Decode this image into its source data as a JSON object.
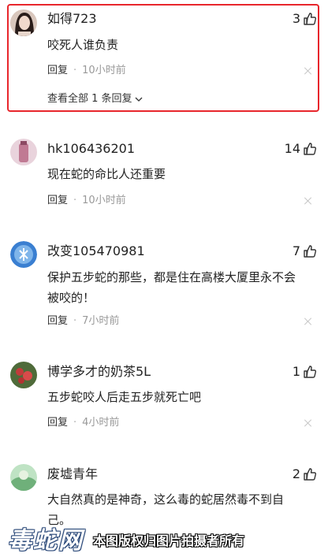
{
  "colors": {
    "highlight_border": "#e8262c",
    "meta_time": "#999999",
    "text": "#222222"
  },
  "comments": [
    {
      "username": "如得723",
      "likes": "3",
      "text": "咬死人谁负责",
      "reply_label": "回复",
      "separator": "·",
      "time": "10小时前",
      "view_all": "查看全部 1 条回复",
      "avatar_icon": "woman-portrait-icon"
    },
    {
      "username": "hk106436201",
      "likes": "14",
      "text": "现在蛇的命比人还重要",
      "reply_label": "回复",
      "separator": "·",
      "time": "10小时前",
      "avatar_icon": "pink-bottle-icon"
    },
    {
      "username": "改变105470981",
      "likes": "7",
      "text_line1": "保护五步蛇的那些，都是住在高楼大厦里永不会",
      "text_line2": "被咬的！",
      "reply_label": "回复",
      "separator": "·",
      "time": "7小时前",
      "avatar_icon": "blue-ice-icon"
    },
    {
      "username": "博学多才的奶茶5L",
      "likes": "1",
      "text": "五步蛇咬人后走五步就死亡吧",
      "reply_label": "回复",
      "separator": "·",
      "time": "4小时前",
      "avatar_icon": "red-flower-icon"
    },
    {
      "username": "废墟青年",
      "likes": "2",
      "text_line1": "大自然真的是神奇，这么毒的蛇居然毒不到自",
      "text_line2": "己。",
      "avatar_icon": "green-landscape-icon"
    }
  ],
  "watermark": {
    "logo": "毒蛇网",
    "caption": "本图版权归图片拍摄者所有"
  }
}
